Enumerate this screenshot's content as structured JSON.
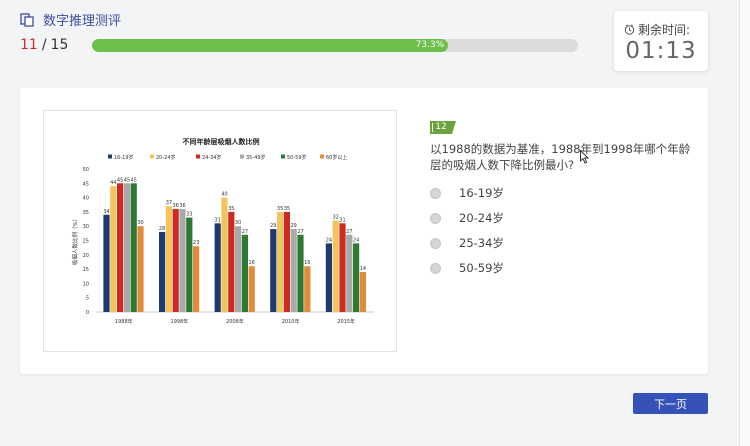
{
  "header": {
    "title": "数字推理测评"
  },
  "progress": {
    "current": "11",
    "separator": "/",
    "total": "15",
    "percent": 73.3,
    "percent_label": "73.3%"
  },
  "timer": {
    "label": "剩余时间:",
    "value": "01:13"
  },
  "question": {
    "number": "12",
    "stem": "以1988的数据为基准，1988年到1998年哪个年龄层的吸烟人数下降比例最小?",
    "options": [
      {
        "label": "16-19岁"
      },
      {
        "label": "20-24岁"
      },
      {
        "label": "25-34岁"
      },
      {
        "label": "50-59岁"
      }
    ]
  },
  "next_button": {
    "label": "下一页"
  },
  "colors": {
    "accent": "#3651b8",
    "progress": "#6cbf4a",
    "current": "#c83228"
  },
  "chart_data": {
    "type": "bar",
    "title": "不同年龄层吸烟人数比例",
    "ylabel": "吸烟人数比例（%）",
    "xlabel": "",
    "ylim": [
      0,
      50
    ],
    "yticks": [
      0,
      5,
      10,
      15,
      20,
      25,
      30,
      35,
      40,
      45,
      50
    ],
    "categories": [
      "1988年",
      "1998年",
      "2008年",
      "2010年",
      "2015年"
    ],
    "legend_position": "top",
    "series": [
      {
        "name": "16-19岁",
        "color": "#1f3a6e",
        "values": [
          34,
          28,
          31,
          29,
          24
        ]
      },
      {
        "name": "20-24岁",
        "color": "#f2c45c",
        "values": [
          44,
          37,
          40,
          35,
          32
        ]
      },
      {
        "name": "24-34岁",
        "color": "#cc2a22",
        "values": [
          45,
          36,
          35,
          35,
          31
        ]
      },
      {
        "name": "35-49岁",
        "color": "#a9a9a9",
        "values": [
          45,
          36,
          30,
          29,
          27
        ]
      },
      {
        "name": "50-59岁",
        "color": "#2e7a32",
        "values": [
          45,
          33,
          27,
          27,
          24
        ]
      },
      {
        "name": "60岁以上",
        "color": "#e08c3c",
        "values": [
          30,
          23,
          16,
          16,
          14
        ]
      }
    ]
  }
}
